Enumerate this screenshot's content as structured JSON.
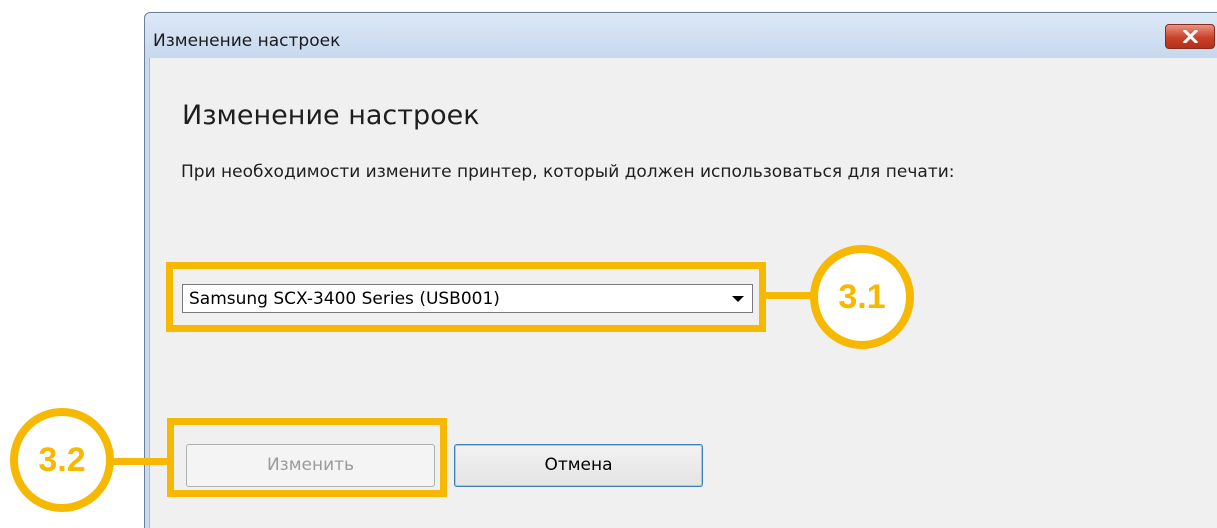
{
  "window": {
    "title": "Изменение настроек"
  },
  "content": {
    "heading": "Изменение настроек",
    "description": "При необходимости измените принтер, который должен использоваться для печати:"
  },
  "printer_select": {
    "value": "Samsung SCX-3400 Series (USB001)"
  },
  "buttons": {
    "change_label": "Изменить",
    "cancel_label": "Отмена"
  },
  "callouts": {
    "printer": "3.1",
    "change": "3.2"
  },
  "colors": {
    "callout": "#f6b800",
    "close_button": "#c7422b",
    "dialog_background": "#f0f0f0"
  },
  "icons": {
    "close": "close-icon",
    "dropdown": "chevron-down-icon"
  }
}
